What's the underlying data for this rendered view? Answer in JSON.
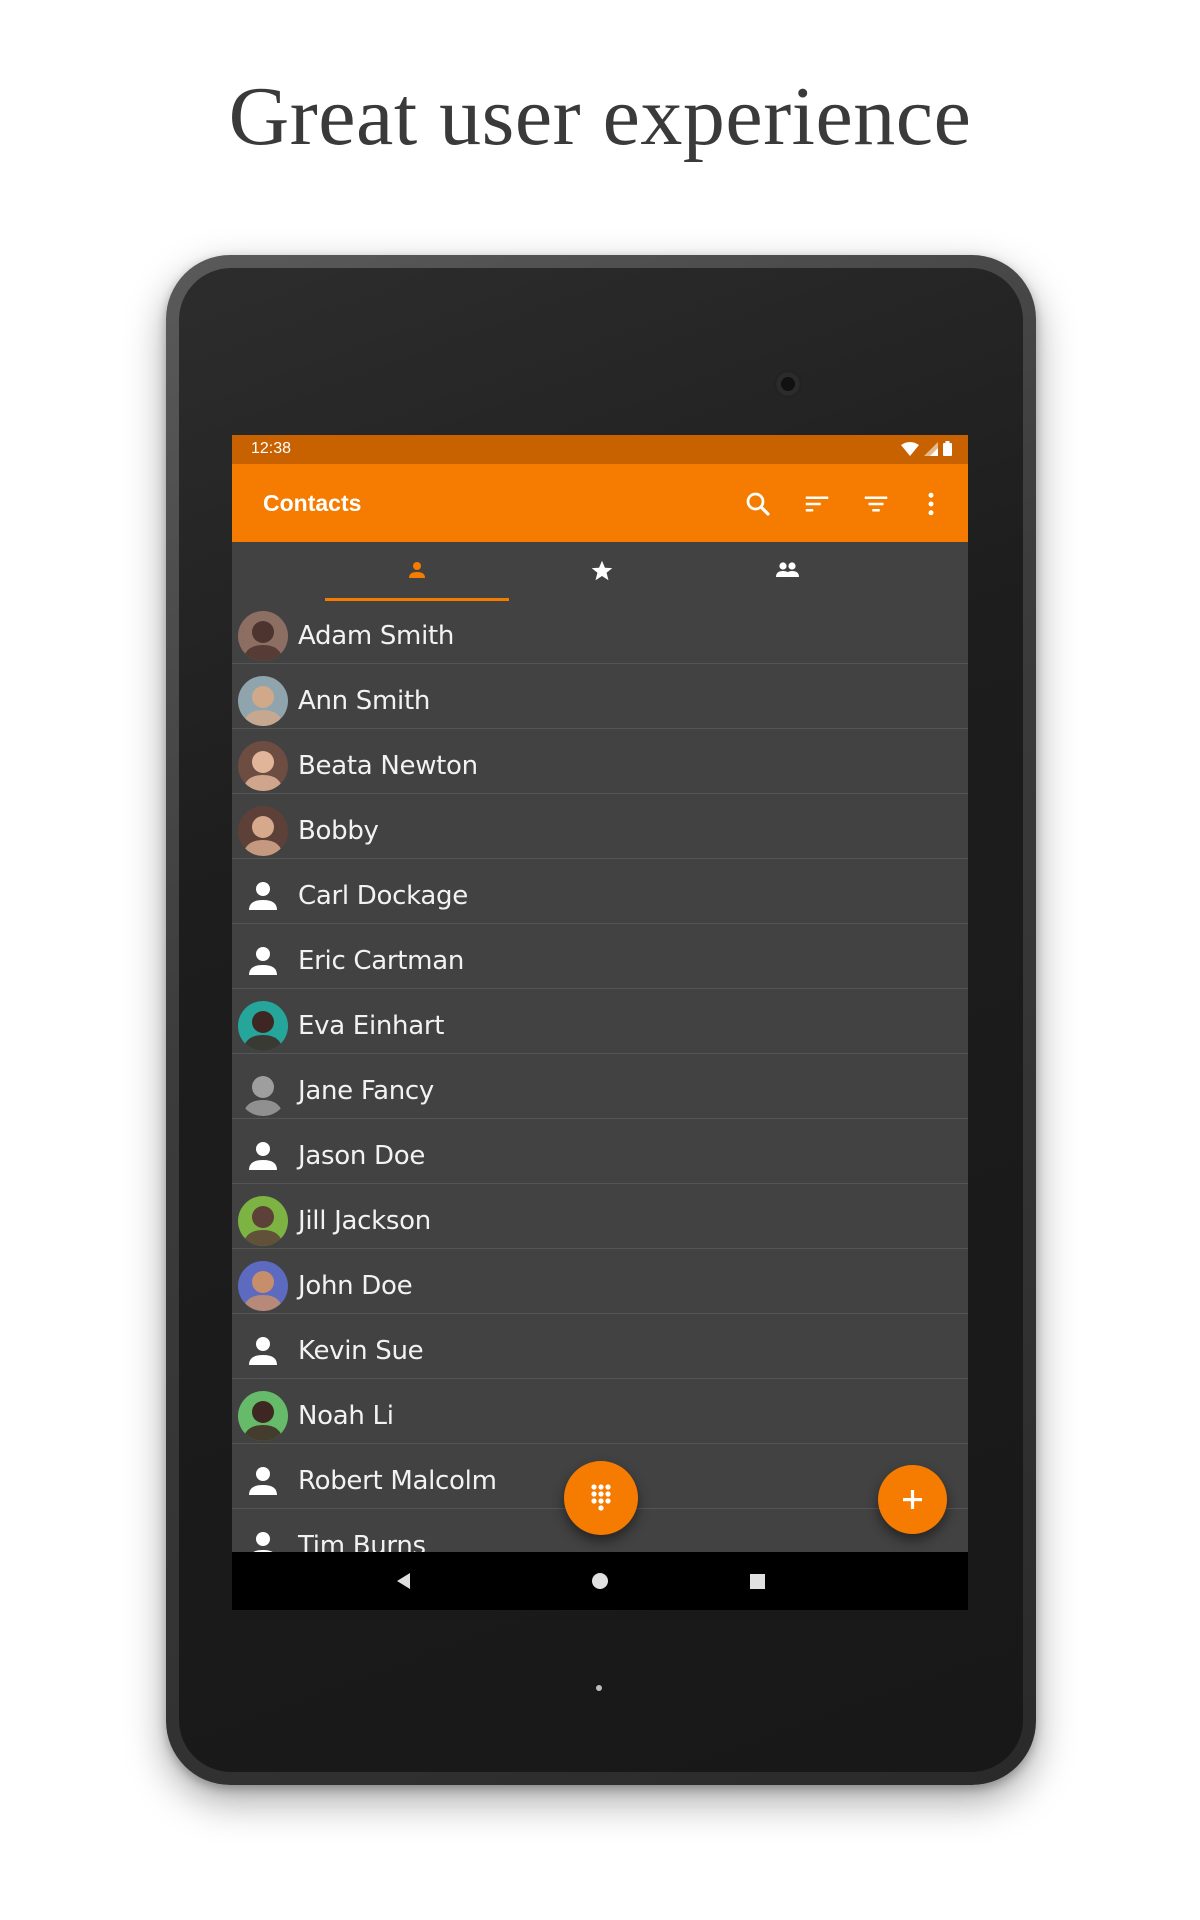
{
  "headline": "Great user experience",
  "colors": {
    "accent": "#f57c00",
    "status_bar": "#c86200",
    "list_background": "#424242"
  },
  "status_bar": {
    "time": "12:38",
    "icons": [
      "wifi-icon",
      "signal-icon",
      "battery-icon"
    ]
  },
  "app_bar": {
    "title": "Contacts",
    "actions": [
      "search-icon",
      "sort-icon",
      "filter-icon",
      "more-vert-icon"
    ]
  },
  "tabs": [
    {
      "icon": "person-icon",
      "selected": true
    },
    {
      "icon": "star-icon",
      "selected": false
    },
    {
      "icon": "group-icon",
      "selected": false
    }
  ],
  "contacts": [
    {
      "name": "Adam Smith",
      "avatar": "photo"
    },
    {
      "name": "Ann Smith",
      "avatar": "photo"
    },
    {
      "name": "Beata Newton",
      "avatar": "photo"
    },
    {
      "name": "Bobby",
      "avatar": "photo"
    },
    {
      "name": "Carl Dockage",
      "avatar": "placeholder"
    },
    {
      "name": "Eric Cartman",
      "avatar": "placeholder"
    },
    {
      "name": "Eva Einhart",
      "avatar": "photo"
    },
    {
      "name": "Jane Fancy",
      "avatar": "photo"
    },
    {
      "name": "Jason Doe",
      "avatar": "placeholder"
    },
    {
      "name": "Jill Jackson",
      "avatar": "photo"
    },
    {
      "name": "John Doe",
      "avatar": "photo"
    },
    {
      "name": "Kevin Sue",
      "avatar": "placeholder"
    },
    {
      "name": "Noah Li",
      "avatar": "photo"
    },
    {
      "name": "Robert Malcolm",
      "avatar": "placeholder"
    },
    {
      "name": "Tim Burns",
      "avatar": "placeholder"
    }
  ],
  "fabs": [
    "dialpad-icon",
    "add-icon"
  ],
  "nav_bar": [
    "back-icon",
    "home-icon",
    "recents-icon"
  ]
}
